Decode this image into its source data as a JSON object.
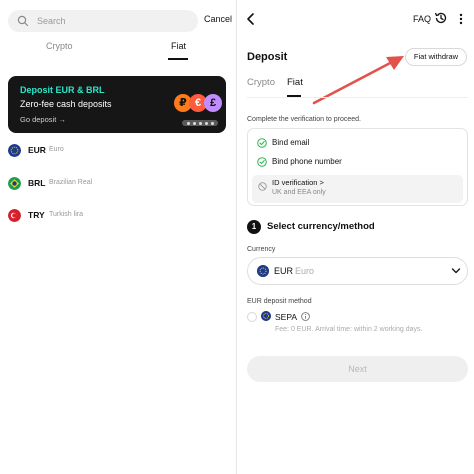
{
  "colors": {
    "accent_teal": "#2ee6c9",
    "arrow_red": "#e2524a",
    "check_green": "#2fb552",
    "promo_bg": "#161616"
  },
  "left": {
    "search": {
      "placeholder": "Search",
      "icon": "search-icon"
    },
    "cancel_label": "Cancel",
    "tabs": [
      {
        "label": "Crypto",
        "active": false
      },
      {
        "label": "Fiat",
        "active": true
      }
    ],
    "promo": {
      "title": "Deposit EUR & BRL",
      "subtitle": "Zero-fee cash deposits",
      "link": "Go deposit →",
      "coins": [
        "₽",
        "€",
        "£"
      ]
    },
    "currencies": [
      {
        "code": "EUR",
        "name": "Euro",
        "flag_color": "#1e3a8a",
        "icon": "eu-flag-icon"
      },
      {
        "code": "BRL",
        "name": "Brazilian Real",
        "flag_color": "#1f9d4f",
        "icon": "brazil-flag-icon"
      },
      {
        "code": "TRY",
        "name": "Turkish lira",
        "flag_color": "#d61f2c",
        "icon": "turkey-flag-icon"
      }
    ]
  },
  "right": {
    "header": {
      "faq_label": "FAQ",
      "icons": [
        "back-icon",
        "history-icon",
        "more-icon"
      ]
    },
    "title": "Deposit",
    "fiat_withdraw_label": "Fiat withdraw",
    "tabs": [
      {
        "label": "Crypto",
        "active": false
      },
      {
        "label": "Fiat",
        "active": true
      }
    ],
    "verification": {
      "intro": "Complete the verification to proceed.",
      "items": [
        {
          "label": "Bind email",
          "done": true
        },
        {
          "label": "Bind phone number",
          "done": true
        }
      ],
      "id_label": "ID verification >",
      "id_sub": "UK and EEA only"
    },
    "step": {
      "number": "1",
      "title": "Select currency/method"
    },
    "currency_field": {
      "label": "Currency",
      "code": "EUR",
      "name": "Euro"
    },
    "method_field": {
      "label": "EUR deposit method",
      "option_label": "SEPA",
      "option_note": "Fee: 0 EUR. Arrival time: within 2 working days."
    },
    "next_label": "Next"
  }
}
